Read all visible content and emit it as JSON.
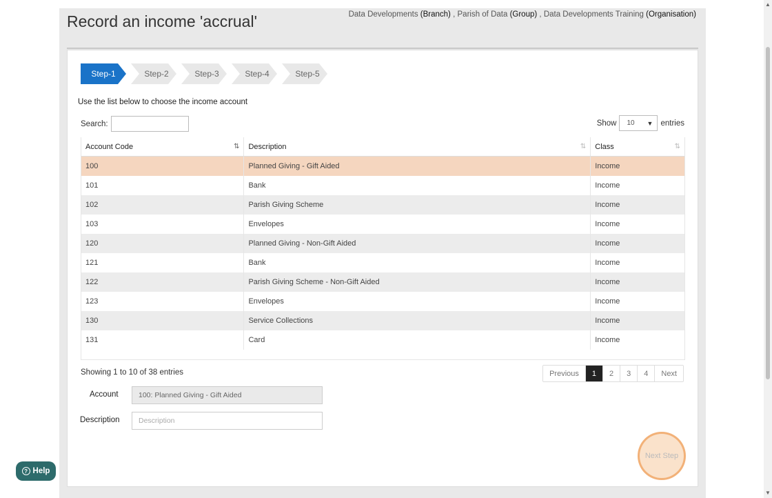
{
  "header": {
    "title": "Record an income 'accrual'",
    "org": {
      "branch": "Data Developments",
      "branch_type": "(Branch)",
      "group": "Parish of Data",
      "group_type": "(Group)",
      "organisation": "Data Developments Training",
      "organisation_type": "(Organisation)",
      "sep1": ",",
      "sep2": ","
    }
  },
  "steps": [
    "Step-1",
    "Step-2",
    "Step-3",
    "Step-4",
    "Step-5"
  ],
  "active_step": "Step-1",
  "instruction": "Use the list below to choose the income account",
  "search": {
    "label": "Search:",
    "value": ""
  },
  "show": {
    "label": "Show",
    "value": "10",
    "suffix": "entries"
  },
  "table": {
    "columns": [
      "Account Code",
      "Description",
      "Class"
    ],
    "rows": [
      {
        "code": "100",
        "description": "Planned Giving - Gift Aided",
        "class": "Income",
        "selected": true
      },
      {
        "code": "101",
        "description": "Bank",
        "class": "Income"
      },
      {
        "code": "102",
        "description": "Parish Giving Scheme",
        "class": "Income"
      },
      {
        "code": "103",
        "description": "Envelopes",
        "class": "Income"
      },
      {
        "code": "120",
        "description": "Planned Giving - Non-Gift Aided",
        "class": "Income"
      },
      {
        "code": "121",
        "description": "Bank",
        "class": "Income"
      },
      {
        "code": "122",
        "description": "Parish Giving Scheme - Non-Gift Aided",
        "class": "Income"
      },
      {
        "code": "123",
        "description": "Envelopes",
        "class": "Income"
      },
      {
        "code": "130",
        "description": "Service Collections",
        "class": "Income"
      },
      {
        "code": "131",
        "description": "Card",
        "class": "Income"
      }
    ]
  },
  "info": "Showing 1 to 10 of 38 entries",
  "pagination": {
    "previous": "Previous",
    "pages": [
      "1",
      "2",
      "3",
      "4"
    ],
    "current": "1",
    "next": "Next"
  },
  "form": {
    "account_label": "Account",
    "account_value": "100: Planned Giving - Gift Aided",
    "description_label": "Description",
    "description_placeholder": "Description"
  },
  "next_step_label": "Next Step",
  "help_label": "Help",
  "colors": {
    "accent": "#1a73c8",
    "selected_row": "#f5d6bf",
    "help": "#2d6b6b"
  }
}
